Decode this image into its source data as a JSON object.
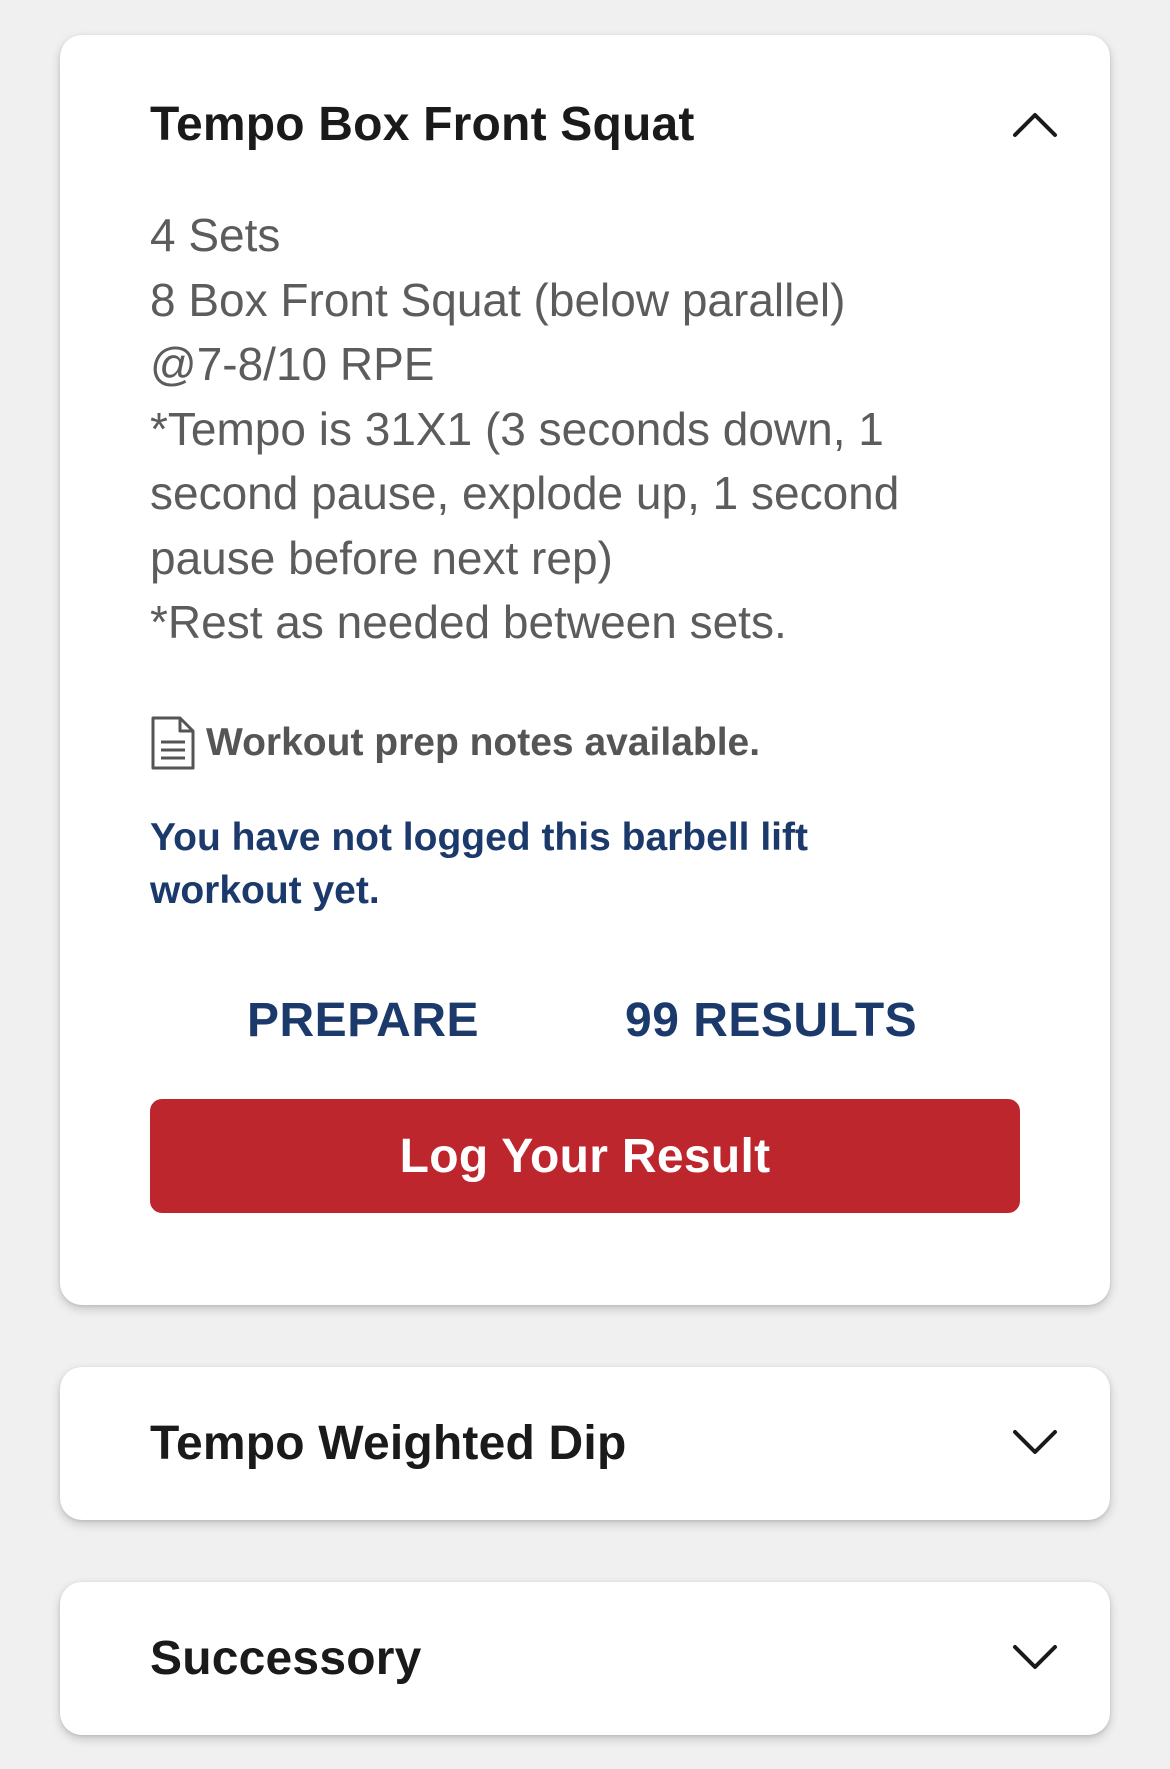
{
  "workouts": [
    {
      "title": "Tempo Box Front Squat",
      "expanded": true,
      "chevron_icon": "chevron-up-icon",
      "description_lines": [
        "4 Sets",
        "8 Box Front Squat (below parallel)",
        "@7-8/10 RPE",
        "*Tempo is 31X1 (3 seconds down, 1 second pause, explode up, 1 second pause before next rep)",
        "*Rest as needed between sets."
      ],
      "notes_icon": "document-icon",
      "notes_text": "Workout prep notes available.",
      "status_text": "You have not logged this barbell lift workout yet.",
      "prepare_label": "PREPARE",
      "results_label": "99 RESULTS",
      "log_button_label": "Log Your Result"
    },
    {
      "title": "Tempo Weighted Dip",
      "expanded": false,
      "chevron_icon": "chevron-down-icon"
    },
    {
      "title": "Successory",
      "expanded": false,
      "chevron_icon": "chevron-down-icon"
    }
  ],
  "colors": {
    "background": "#f0f0f0",
    "card": "#ffffff",
    "title_text": "#1a1a1a",
    "body_text": "#5c5c5c",
    "link_navy": "#1b3a6b",
    "button_red": "#be262e",
    "button_text": "#ffffff"
  }
}
